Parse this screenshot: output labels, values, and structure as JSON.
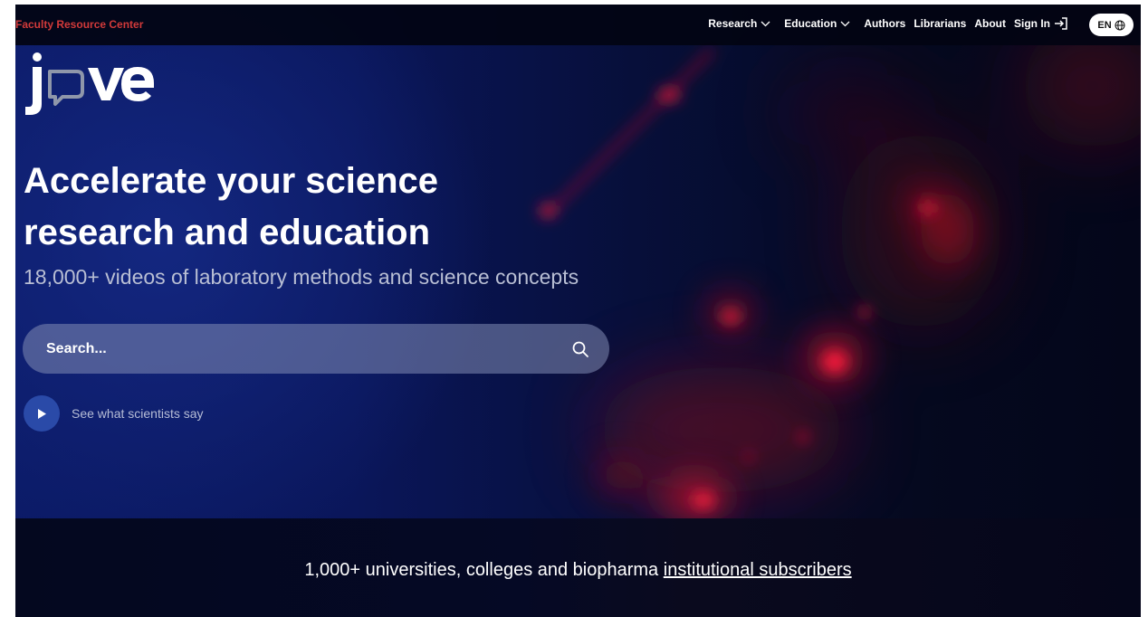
{
  "topbar": {
    "faculty_link": "Faculty Resource Center",
    "nav": {
      "research": "Research",
      "education": "Education",
      "authors": "Authors",
      "librarians": "Librarians",
      "about": "About",
      "sign_in": "Sign In"
    },
    "language": "EN"
  },
  "logo": {
    "text": "jove",
    "icon": "jove-logo"
  },
  "hero": {
    "headline_line1": "Accelerate your science",
    "headline_line2": "research and education",
    "subhead": "18,000+ videos of laboratory methods and science concepts",
    "search": {
      "placeholder": "Search...",
      "icon": "search-icon"
    },
    "video_link": {
      "label": "See what scientists say",
      "icon": "play-icon"
    }
  },
  "band": {
    "text": "1,000+ universities, colleges and biopharma",
    "link": "institutional subscribers"
  },
  "colors": {
    "accent_red": "#d23a3a",
    "hero_blue": "#0b1a66",
    "play_button": "#2a4aa8"
  }
}
